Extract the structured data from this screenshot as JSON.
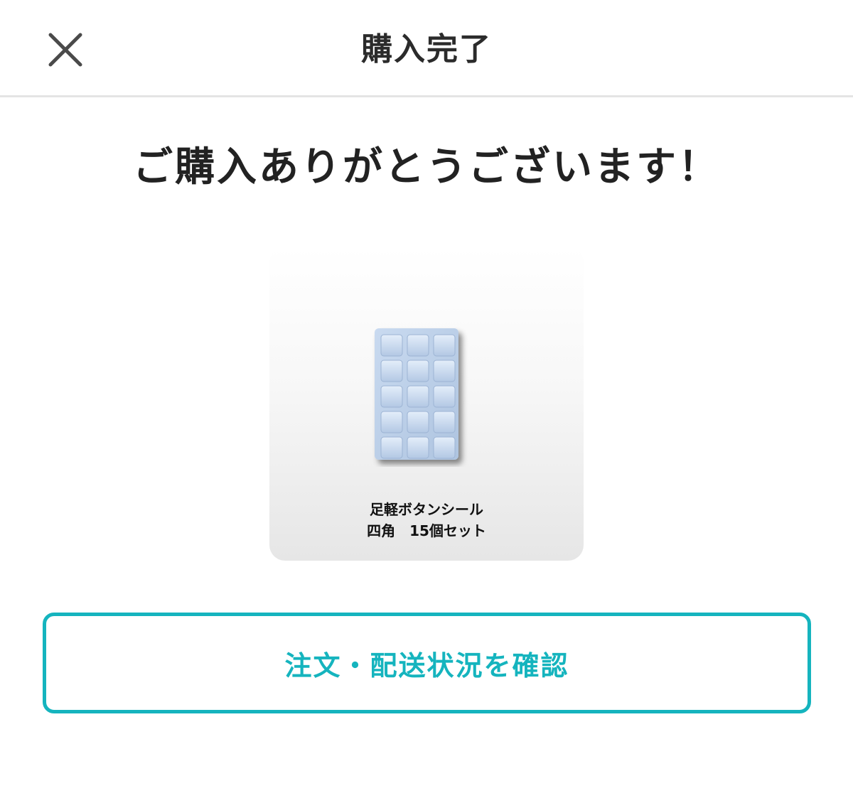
{
  "header": {
    "title": "購入完了",
    "close_icon": "close-icon"
  },
  "main": {
    "thanks_message": "ご購入ありがとうございます！",
    "product": {
      "name": "足軽ボタンシール",
      "subtitle": "四角　15個セット",
      "image_icon": "button-sticker-sheet"
    },
    "order_status_button": "注文・配送状況を確認"
  },
  "colors": {
    "accent": "#15b4be",
    "text": "#2b2b2b",
    "divider": "#e4e4e4"
  }
}
